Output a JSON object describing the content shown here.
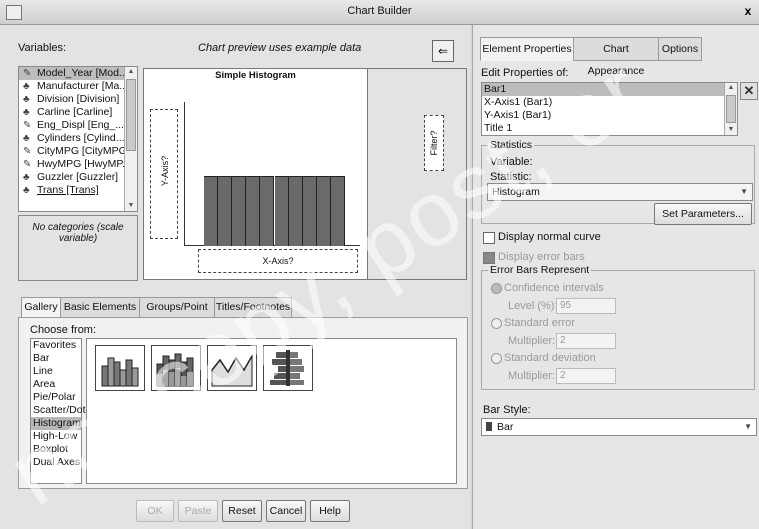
{
  "window": {
    "title": "Chart Builder",
    "close_glyph": "x"
  },
  "left": {
    "variables_label": "Variables:",
    "preview_note": "Chart preview uses example data",
    "variables": [
      {
        "label": "Model_Year [Mod...",
        "icon": "scale-icon"
      },
      {
        "label": "Manufacturer [Ma...",
        "icon": "nominal-icon"
      },
      {
        "label": "Division [Division]",
        "icon": "nominal-icon"
      },
      {
        "label": "Carline [Carline]",
        "icon": "nominal-icon"
      },
      {
        "label": "Eng_Displ [Eng_...",
        "icon": "scale-icon"
      },
      {
        "label": "Cylinders [Cylind...",
        "icon": "nominal-icon"
      },
      {
        "label": "CityMPG [CityMPG]",
        "icon": "scale-icon"
      },
      {
        "label": "HwyMPG [HwyMP...",
        "icon": "scale-icon"
      },
      {
        "label": "Guzzler [Guzzler]",
        "icon": "nominal-icon"
      },
      {
        "label": "Trans [Trans]",
        "icon": "nominal-icon"
      }
    ],
    "no_categories": "No categories (scale variable)",
    "preview": {
      "title": "Simple Histogram",
      "y_axis": "Y-Axis?",
      "x_axis": "X-Axis?",
      "filter": "Filter?",
      "bars": 10
    },
    "tabs": [
      "Gallery",
      "Basic Elements",
      "Groups/Point ID",
      "Titles/Footnotes"
    ],
    "choose_from_label": "Choose from:",
    "chart_types": [
      "Favorites",
      "Bar",
      "Line",
      "Area",
      "Pie/Polar",
      "Scatter/Dot",
      "Histogram",
      "High-Low",
      "Boxplot",
      "Dual Axes"
    ],
    "selected_type": "Histogram",
    "buttons": {
      "ok": "OK",
      "paste": "Paste",
      "reset": "Reset",
      "cancel": "Cancel",
      "help": "Help"
    }
  },
  "right": {
    "tabs": [
      "Element Properties",
      "Chart Appearance",
      "Options"
    ],
    "edit_properties_label": "Edit Properties of:",
    "elements": [
      "Bar1",
      "X-Axis1 (Bar1)",
      "Y-Axis1 (Bar1)",
      "Title 1"
    ],
    "statistics_label": "Statistics",
    "variable_label": "Variable:",
    "statistic_label": "Statistic:",
    "statistic_value": "Histogram",
    "set_parameters": "Set Parameters...",
    "display_normal_curve": "Display normal curve",
    "display_error_bars": "Display error bars",
    "error_bars_represent": "Error Bars Represent",
    "confidence_intervals": "Confidence intervals",
    "level_label": "Level (%):",
    "level_value": "95",
    "standard_error": "Standard error",
    "multiplier_label": "Multiplier:",
    "multiplier_value_1": "2",
    "standard_deviation": "Standard deviation",
    "multiplier_value_2": "2",
    "bar_style_label": "Bar Style:",
    "bar_style_value": "Bar"
  }
}
